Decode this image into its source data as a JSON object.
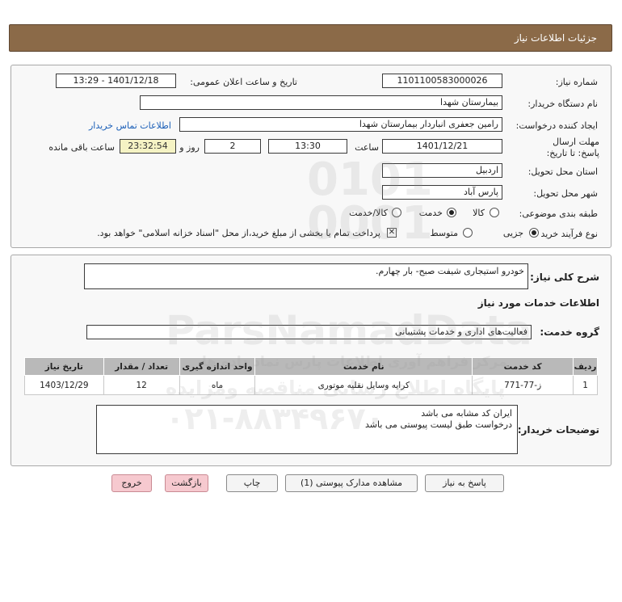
{
  "page": {
    "title": "جزئیات اطلاعات نیاز"
  },
  "form": {
    "need_number_label": "شماره نیاز:",
    "need_number": "1101100583000026",
    "announce_label": "تاریخ و ساعت اعلان عمومی:",
    "announce_value": "1401/12/18 - 13:29",
    "buyer_org_label": "نام دستگاه خریدار:",
    "buyer_org": "بیمارستان شهدا",
    "requester_label": "ایجاد کننده درخواست:",
    "requester": "رامین جعفری انباردار بیمارستان شهدا",
    "contact_link": "اطلاعات تماس خریدار",
    "deadline_label": "مهلت ارسال پاسخ: تا تاریخ:",
    "deadline_date": "1401/12/21",
    "time_label": "ساعت",
    "deadline_time": "13:30",
    "days_value": "2",
    "days_label": "روز و",
    "remaining_time": "23:32:54",
    "remaining_label": "ساعت باقی مانده",
    "province_label": "استان محل تحویل:",
    "province": "اردبیل",
    "city_label": "شهر محل تحویل:",
    "city": "پارس آباد",
    "category_label": "طبقه بندی موضوعی:",
    "category_options": [
      "کالا",
      "خدمت",
      "کالا/خدمت"
    ],
    "category_selected": "خدمت",
    "purchase_type_label": "نوع فرآیند خرید :",
    "purchase_options": [
      "جزیی",
      "متوسط"
    ],
    "purchase_selected": "جزیی",
    "payment_note": "پرداخت تمام یا بخشی از مبلغ خرید،از محل \"اسناد خزانه اسلامی\" خواهد بود."
  },
  "details": {
    "summary_label": "شرح کلی نیاز:",
    "summary": "خودرو استیجاری شیفت صبح- بار چهارم.",
    "services_title": "اطلاعات خدمات مورد نیاز",
    "service_group_label": "گروه خدمت:",
    "service_group": "فعالیت‌های اداری و خدمات پشتیبانی",
    "table": {
      "headers": [
        "ردیف",
        "کد خدمت",
        "نام خدمت",
        "واحد اندازه گیری",
        "تعداد / مقدار",
        "تاریخ نیاز"
      ],
      "rows": [
        [
          "1",
          "ز-77-771",
          "کرایه وسایل نقلیه موتوری",
          "ماه",
          "12",
          "1403/12/29"
        ]
      ]
    },
    "buyer_notes_label": "توضیحات خریدار:",
    "buyer_notes_line1": "ایران کد مشابه می باشد",
    "buyer_notes_line2": "درخواست طبق لیست پیوستی می باشد"
  },
  "buttons": {
    "reply": "پاسخ به نیاز",
    "attachments": "مشاهده مدارک پیوستی (1)",
    "print": "چاپ",
    "back": "بازگشت",
    "exit": "خروج"
  },
  "watermark": {
    "line1": "ParsNamadData",
    "line2": "مرکز فراهم آوری اطلاعات پارس نماد داده ها",
    "line3": "پایگاه اطلاع رسانی مناقصه ومزایده",
    "line4": "۰۲۱-۸۸۳۴۹۶۷۰"
  },
  "colors": {
    "title_bar": "#8b6a48",
    "table_header": "#b9b9b9",
    "remaining_bg": "#f5f3c4",
    "link": "#1b5fb8",
    "exit_button": "#f6c9cf"
  }
}
